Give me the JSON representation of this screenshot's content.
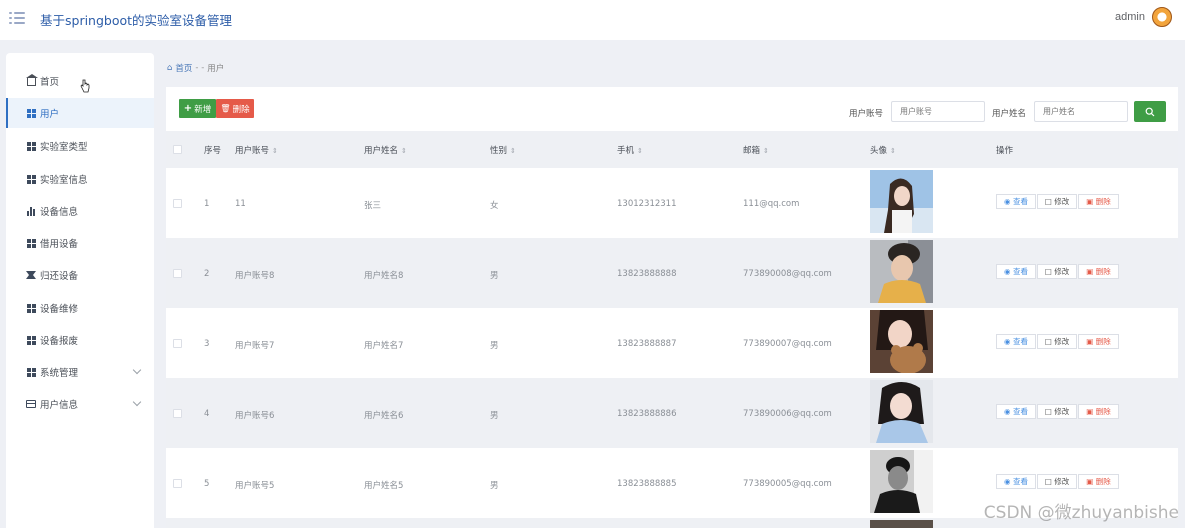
{
  "header": {
    "title": "基于springboot的实验室设备管理",
    "user": "admin"
  },
  "sidebar": {
    "items": [
      {
        "label": "首页",
        "icon": "home-icon"
      },
      {
        "label": "用户",
        "icon": "grid-icon",
        "active": true
      },
      {
        "label": "实验室类型",
        "icon": "grid-icon"
      },
      {
        "label": "实验室信息",
        "icon": "grid-icon"
      },
      {
        "label": "设备信息",
        "icon": "bar-chart-icon"
      },
      {
        "label": "借用设备",
        "icon": "grid-icon"
      },
      {
        "label": "归还设备",
        "icon": "swap-icon"
      },
      {
        "label": "设备维修",
        "icon": "grid-icon"
      },
      {
        "label": "设备报废",
        "icon": "grid-icon"
      },
      {
        "label": "系统管理",
        "icon": "grid-icon",
        "expandable": true
      },
      {
        "label": "用户信息",
        "icon": "card-icon",
        "expandable": true
      }
    ]
  },
  "breadcrumb": {
    "home": "首页",
    "sep": "- -",
    "current": "用户"
  },
  "toolbar": {
    "add_label": "新增",
    "delete_label": "删除"
  },
  "search": {
    "account_label": "用户账号",
    "account_placeholder": "用户账号",
    "name_label": "用户姓名",
    "name_placeholder": "用户姓名"
  },
  "table": {
    "columns": [
      "序号",
      "用户账号",
      "用户姓名",
      "性别",
      "手机",
      "邮箱",
      "头像",
      "操作"
    ],
    "rows": [
      {
        "index": "1",
        "account": "11",
        "name": "张三",
        "gender": "女",
        "phone": "13012312311",
        "email": "111@qq.com"
      },
      {
        "index": "2",
        "account": "用户账号8",
        "name": "用户姓名8",
        "gender": "男",
        "phone": "13823888888",
        "email": "773890008@qq.com"
      },
      {
        "index": "3",
        "account": "用户账号7",
        "name": "用户姓名7",
        "gender": "男",
        "phone": "13823888887",
        "email": "773890007@qq.com"
      },
      {
        "index": "4",
        "account": "用户账号6",
        "name": "用户姓名6",
        "gender": "男",
        "phone": "13823888886",
        "email": "773890006@qq.com"
      },
      {
        "index": "5",
        "account": "用户账号5",
        "name": "用户姓名5",
        "gender": "男",
        "phone": "13823888885",
        "email": "773890005@qq.com"
      }
    ],
    "actions": {
      "view": "查看",
      "edit": "修改",
      "delete": "删除"
    }
  },
  "watermark": "CSDN @微zhuyanbishe",
  "colors": {
    "primary": "#2f6fc2",
    "success": "#3f9d45",
    "danger": "#e55a49"
  }
}
